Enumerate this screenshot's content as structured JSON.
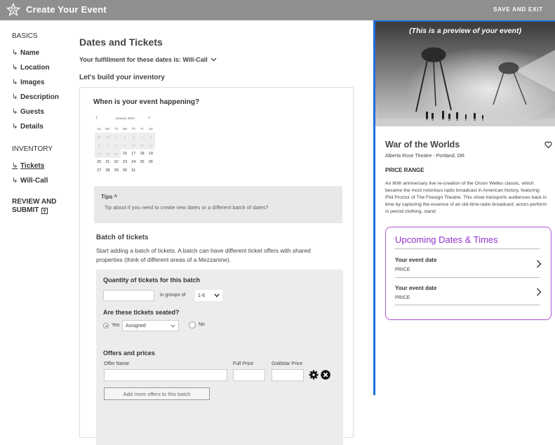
{
  "topbar": {
    "title": "Create Your Event",
    "save_exit": "SAVE AND EXIT"
  },
  "sidebar": {
    "basics_heading": "BASICS",
    "basics_items": [
      {
        "label": "Name"
      },
      {
        "label": "Location"
      },
      {
        "label": "Images"
      },
      {
        "label": "Description"
      },
      {
        "label": "Guests"
      },
      {
        "label": "Details"
      }
    ],
    "inventory_heading": "INVENTORY",
    "inventory_items": [
      {
        "label": "Tickets",
        "active": true
      },
      {
        "label": "Will-Call"
      }
    ],
    "review_line1": "REVIEW AND",
    "review_line2": "SUBMIT",
    "review_icon": "key-icon"
  },
  "main": {
    "title": "Dates and Tickets",
    "fulfillment": "Your fulfillment for these dates is: Will-Call",
    "build_heading": "Let's build your inventory",
    "when_question": "When is your event happening?",
    "calendar": {
      "month": "January 2019",
      "weekdays": [
        "Su",
        "Mo",
        "Tu",
        "We",
        "Th",
        "Fr",
        "Sa"
      ],
      "weeks": [
        [
          "30",
          "31",
          "1",
          "2",
          "3",
          "4",
          "5"
        ],
        [
          "6",
          "7",
          "8",
          "9",
          "10",
          "11",
          "12"
        ],
        [
          "13",
          "14",
          "15",
          "16",
          "17",
          "18",
          "19"
        ],
        [
          "20",
          "21",
          "22",
          "23",
          "24",
          "25",
          "26"
        ],
        [
          "27",
          "28",
          "29",
          "30",
          "31",
          "",
          ""
        ]
      ],
      "first_enabled": "16"
    },
    "tips_label": "Tips ^",
    "tips_text": "Tip about if you need to create new dates or a different batch of dates?",
    "batch_heading": "Batch of tickets",
    "batch_text": "Start adding a batch of tickets. A batch can have different ticket offers with shared properties (think of different areas of a Mezzanine).",
    "quantity_label": "Quantity of tickets for this batch",
    "quantity_value": "",
    "groups_label": "in groups of",
    "groups_value": "1-6",
    "seated_question": "Are these tickets seated?",
    "yes_label": "Yes",
    "assigned_value": "Assigned",
    "no_label": "No",
    "offers_heading": "Offers and prices",
    "offer_name_label": "Offer Name",
    "full_price_label": "Full Price",
    "goldstar_price_label": "Goldstar Price",
    "add_offers_button": "Add more offers to this batch"
  },
  "preview": {
    "caption": "(This is a preview of your event)",
    "event_title": "War of the Worlds",
    "venue": "Alberta Rose Theatre - Portland, OR",
    "price_range": "PRICE RANGE",
    "description": "An 80th anniversary live re-creation of the Orson Welles classic, which became the most notorious radio broadcast in American history, featuring Phil Proctor of The Firesign Theatre. This show transports audiences back in time by capturing the essence of an old-time-radio broadcast: actors perform in period clothing, stand",
    "upcoming_title": "Upcoming Dates & Times",
    "dates": [
      {
        "label": "Your event date",
        "price": "PRICE"
      },
      {
        "label": "Your event date",
        "price": "PRICE"
      }
    ]
  },
  "colors": {
    "topbar": "#8f8f8f",
    "preview_border": "#1e6fd9",
    "upcoming_accent": "#9333cc"
  }
}
